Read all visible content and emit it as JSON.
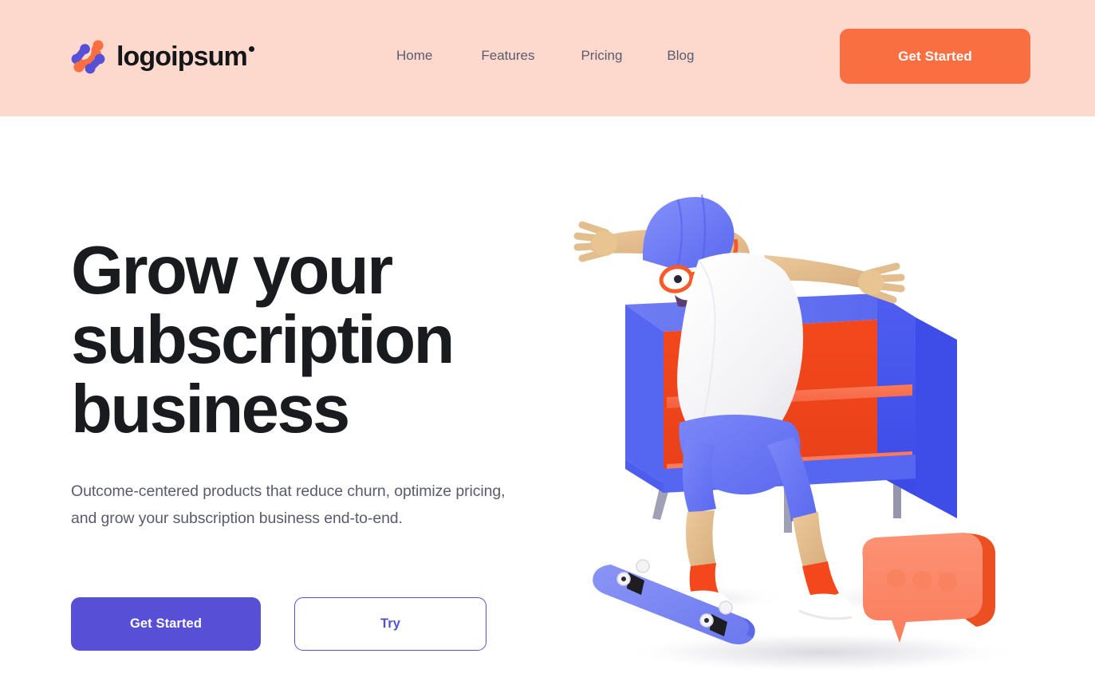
{
  "brand": {
    "name": "logoipsum",
    "mark_colors": {
      "purple": "#5750d6",
      "orange": "#fa6f41"
    }
  },
  "header": {
    "background": "#fdd9cd",
    "nav": [
      {
        "label": "Home"
      },
      {
        "label": "Features"
      },
      {
        "label": "Pricing"
      },
      {
        "label": "Blog"
      }
    ],
    "cta": {
      "label": "Get Started",
      "background": "#fa6f41",
      "text_color": "#ffffff"
    }
  },
  "hero": {
    "title": "Grow your\nsubscription\nbusiness",
    "subtitle": "Outcome-centered products that reduce churn, optimize pricing, and grow your subscription business end-to-end.",
    "primary_button": {
      "label": "Get Started",
      "background": "#5750d6",
      "text_color": "#ffffff"
    },
    "secondary_button": {
      "label": "Try",
      "background": "#ffffff",
      "text_color": "#5750d6",
      "border_color": "#5750d6"
    },
    "illustration": {
      "name": "skateboarder-3d-illustration",
      "colors": {
        "shelf_frame": "#5c6df0",
        "shelf_panel": "#f5491f",
        "shelf_panel_light": "#fb7454",
        "shelf_leg": "#9a9ab0",
        "skin": "#e2bd8d",
        "shirt": "#f6f6f8",
        "shorts": "#6876f5",
        "cap": "#6a7bf6",
        "glasses": "#fa5a2a",
        "socks": "#f5491f",
        "shoes": "#ffffff",
        "skateboard": "#7b86f2",
        "chat_bubble": "#fb8a65",
        "chat_bubble_side": "#ec4f22"
      }
    }
  },
  "page": {
    "background": "#ffffff"
  }
}
